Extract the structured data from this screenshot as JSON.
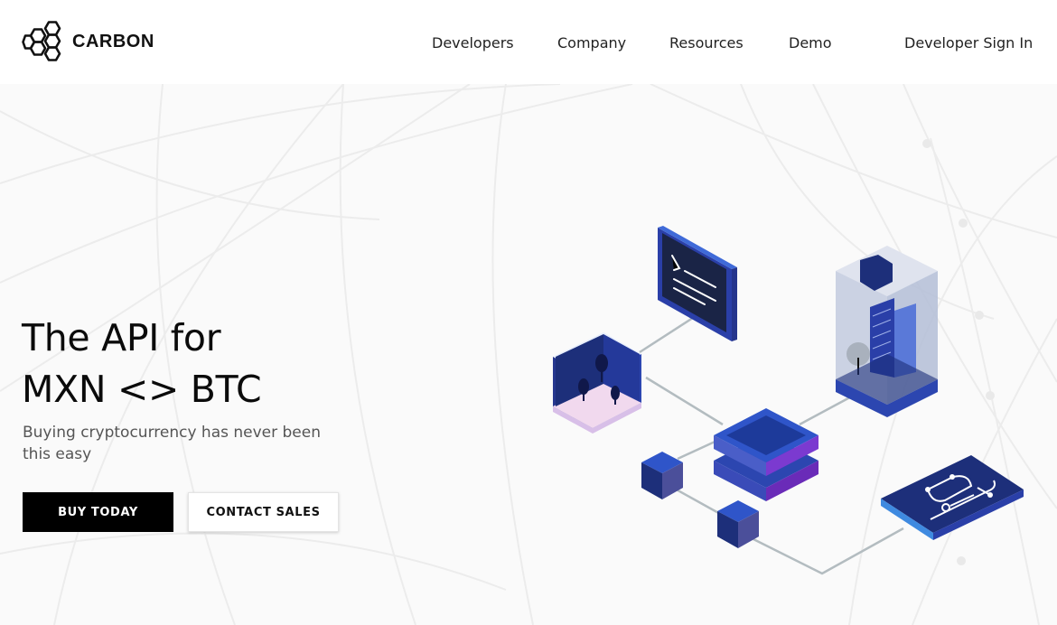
{
  "header": {
    "logo": {
      "icon": "hexagon-cluster-icon",
      "text": "CARBON"
    },
    "nav": [
      {
        "label": "Developers"
      },
      {
        "label": "Company"
      },
      {
        "label": "Resources"
      },
      {
        "label": "Demo"
      },
      {
        "label": "Developer Sign In"
      }
    ]
  },
  "hero": {
    "headline_line1": "The API for",
    "headline_line2": "MXN <> BTC",
    "subhead": "Buying cryptocurrency has never been this easy",
    "buttons": {
      "primary": "BUY TODAY",
      "secondary": "CONTACT SALES"
    }
  },
  "colors": {
    "primary_button": "#000000",
    "illustration_navy": "#1d2f7a",
    "illustration_blue": "#2f55c9",
    "illustration_purple": "#6a2bb8"
  }
}
